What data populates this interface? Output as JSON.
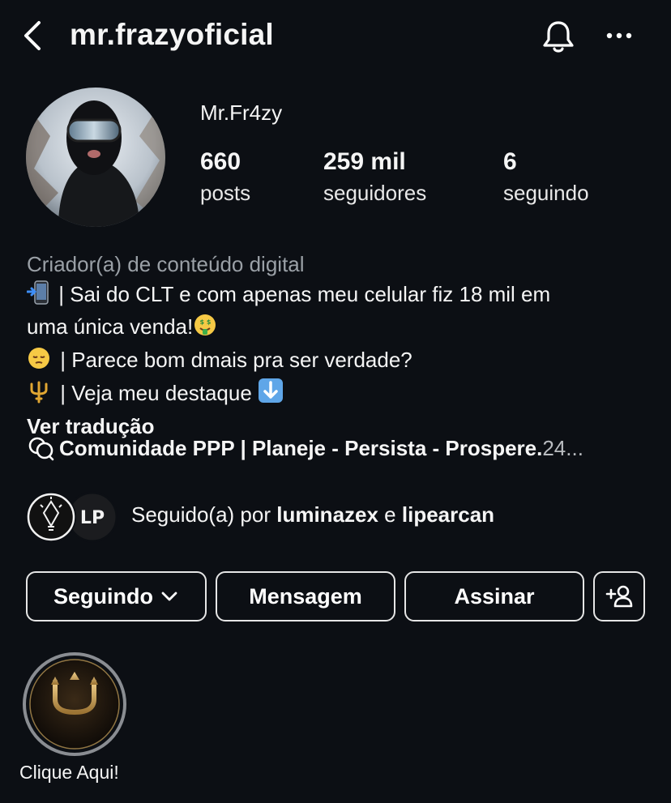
{
  "header": {
    "username": "mr.frazyoficial",
    "back_icon": "chevron-left-icon",
    "bell_icon": "bell-icon",
    "more_icon": "more-horizontal-icon"
  },
  "profile": {
    "display_name": "Mr.Fr4zy",
    "stats": [
      {
        "value": "660",
        "label": "posts"
      },
      {
        "value": "259 mil",
        "label": "seguidores"
      },
      {
        "value": "6",
        "label": "seguindo"
      }
    ]
  },
  "bio": {
    "category": "Criador(a) de conteúdo digital",
    "line1": " | Sai do CLT e com apenas meu celular fiz 18 mil em",
    "line2": "uma única venda!",
    "line3": " | Parece bom dmais pra ser verdade?",
    "line4": " | Veja meu destaque ",
    "translate": "Ver tradução"
  },
  "community": {
    "title": "Comunidade PPP | Planeje - Persista - Prospere.",
    "suffix": " 24...",
    "icon": "threads-icon"
  },
  "followed_by": {
    "prefix": "Seguido(a) por ",
    "user1": "luminazex",
    "connector": " e ",
    "user2": "lipearcan",
    "avatar2_text": "LP"
  },
  "actions": {
    "following": "Seguindo",
    "message": "Mensagem",
    "subscribe": "Assinar",
    "add_icon": "add-user-icon"
  },
  "highlights": [
    {
      "label": "Clique Aqui!",
      "icon": "trident-icon"
    }
  ],
  "colors": {
    "background": "#0c0f14",
    "text": "#f5f5f5",
    "muted": "#9aa0a6",
    "gold": "#c9a25a"
  }
}
